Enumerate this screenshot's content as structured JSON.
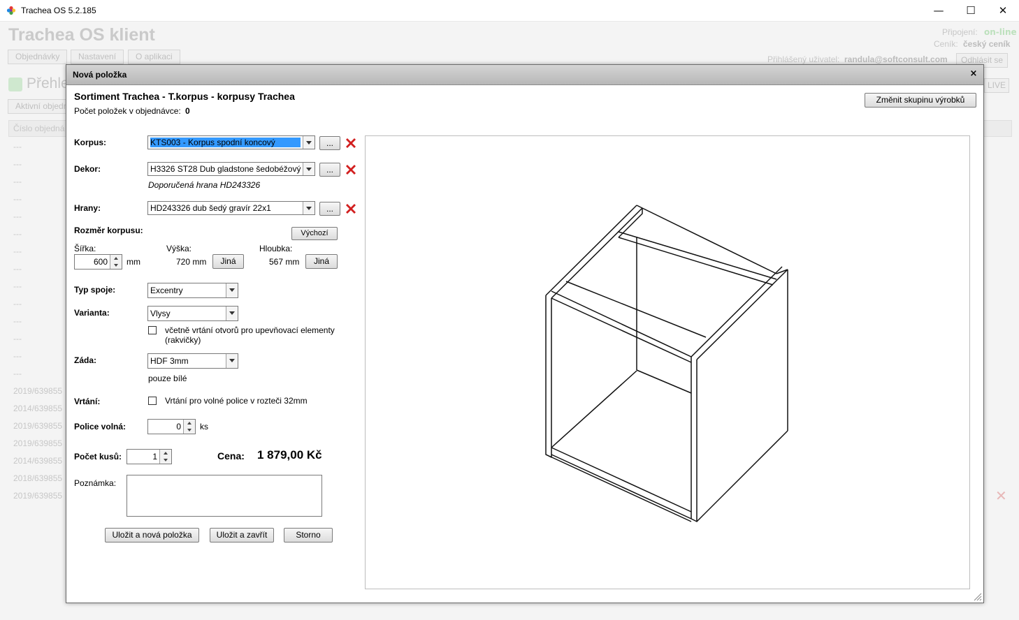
{
  "window": {
    "title": "Trachea OS 5.2.185",
    "minimize": "—",
    "maximize": "☐",
    "close": "✕"
  },
  "background": {
    "app_title": "Trachea OS klient",
    "tabs": [
      "Objednávky",
      "Nastavení",
      "O aplikaci"
    ],
    "connection_label": "Připojení:",
    "connection_value": "on-line",
    "pricelist_label": "Ceník:",
    "pricelist_value": "český ceník",
    "user_label": "Přihlášený uživatel:",
    "user_value": "randula@softconsult.com",
    "logout_label": "Odhlásit se",
    "overview_title": "Přehle",
    "active_orders": "Aktivní objedn",
    "live_label": "LIVE",
    "column_header": "Číslo objedná",
    "rows": [
      "---",
      "---",
      "---",
      "---",
      "---",
      "---",
      "---",
      "---",
      "---",
      "---",
      "---",
      "---",
      "---",
      "---",
      "2019/639855",
      "2014/639855",
      "2019/639855",
      "2019/639855",
      "2014/639855",
      "2018/639855",
      "2019/639855"
    ]
  },
  "dialog": {
    "title": "Nová položka",
    "close": "×",
    "heading": "Sortiment Trachea - T.korpus - korpusy Trachea",
    "count_label": "Počet položek v objednávce:",
    "count_value": "0",
    "change_group_button": "Změnit skupinu výrobků",
    "korpus": {
      "label": "Korpus:",
      "value": "KTS003 - Korpus spodní koncový",
      "browse": "..."
    },
    "dekor": {
      "label": "Dekor:",
      "value": "H3326 ST28 Dub gladstone šedobéžový",
      "browse": "...",
      "hint": "Doporučená hrana HD243326"
    },
    "hrany": {
      "label": "Hrany:",
      "value": "HD243326 dub šedý gravír 22x1",
      "browse": "..."
    },
    "dimensions": {
      "label": "Rozměr korpusu:",
      "default_button": "Výchozí",
      "width_label": "Šířka:",
      "width_value": "600",
      "width_unit": "mm",
      "height_label": "Výška:",
      "height_value": "720 mm",
      "height_button": "Jiná",
      "depth_label": "Hloubka:",
      "depth_value": "567 mm",
      "depth_button": "Jiná"
    },
    "joint": {
      "label": "Typ spoje:",
      "value": "Excentry"
    },
    "variant": {
      "label": "Varianta:",
      "value": "Vlysy",
      "checkbox_text_1": "včetně vrtání otvorů pro upevňovací elementy",
      "checkbox_text_2": "(rakvičky)"
    },
    "back": {
      "label": "Záda:",
      "value": "HDF 3mm",
      "hint": "pouze bílé"
    },
    "drilling": {
      "label": "Vrtání:",
      "checkbox_text": "Vrtání pro volné police v rozteči 32mm"
    },
    "shelves": {
      "label": "Police volná:",
      "value": "0",
      "unit": "ks"
    },
    "quantity": {
      "label": "Počet kusů:",
      "value": "1"
    },
    "price": {
      "label": "Cena:",
      "value": "1 879,00 Kč"
    },
    "note": {
      "label": "Poznámka:",
      "value": ""
    },
    "buttons": {
      "save_new": "Uložit a nová položka",
      "save_close": "Uložit a zavřít",
      "cancel": "Storno"
    }
  },
  "colors": {
    "remove_icon": "#d21f1f",
    "online": "#2db52d",
    "selection": "#3399ff"
  }
}
